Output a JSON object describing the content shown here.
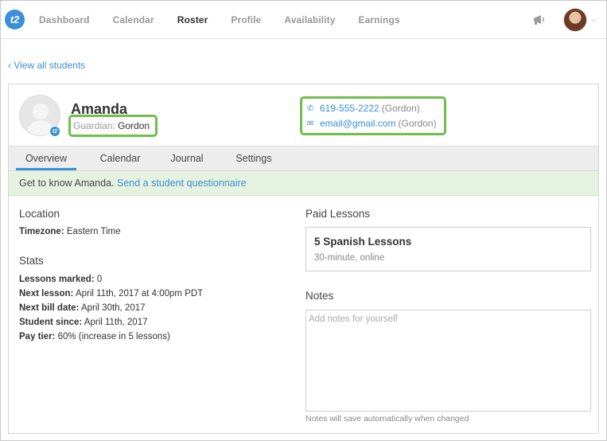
{
  "nav": {
    "logo_text": "t2",
    "items": [
      {
        "label": "Dashboard"
      },
      {
        "label": "Calendar"
      },
      {
        "label": "Roster"
      },
      {
        "label": "Profile"
      },
      {
        "label": "Availability"
      },
      {
        "label": "Earnings"
      }
    ],
    "active": "Roster"
  },
  "back_link": "‹ View all students",
  "student": {
    "name": "Amanda",
    "guardian_label": "Guardian:",
    "guardian_name": "Gordon",
    "badge_text": "t2"
  },
  "contact": {
    "phone": "619-555-2222",
    "phone_owner": "(Gordon)",
    "email": "email@gmail.com",
    "email_owner": "(Gordon)"
  },
  "tabs": [
    {
      "label": "Overview"
    },
    {
      "label": "Calendar"
    },
    {
      "label": "Journal"
    },
    {
      "label": "Settings"
    }
  ],
  "active_tab": "Overview",
  "banner": {
    "text": "Get to know Amanda.",
    "link": "Send a student questionnaire"
  },
  "location": {
    "title": "Location",
    "timezone_label": "Timezone:",
    "timezone_value": "Eastern Time"
  },
  "stats": {
    "title": "Stats",
    "rows": [
      {
        "label": "Lessons marked:",
        "value": "0"
      },
      {
        "label": "Next lesson:",
        "value": "April 11th, 2017 at 4:00pm PDT"
      },
      {
        "label": "Next bill date:",
        "value": "April 30th, 2017"
      },
      {
        "label": "Student since:",
        "value": "April 11th, 2017"
      },
      {
        "label": "Pay tier:",
        "value": "60% (increase in 5 lessons)"
      }
    ]
  },
  "paid_lessons": {
    "title": "Paid Lessons",
    "lesson_title": "5 Spanish Lessons",
    "lesson_detail": "30-minute, online"
  },
  "notes": {
    "title": "Notes",
    "placeholder": "Add notes for yourself",
    "hint": "Notes will save automatically when changed"
  },
  "colors": {
    "accent": "#3a8fd6",
    "highlight": "#6fbf4a",
    "banner_bg": "#e6f2e0"
  }
}
